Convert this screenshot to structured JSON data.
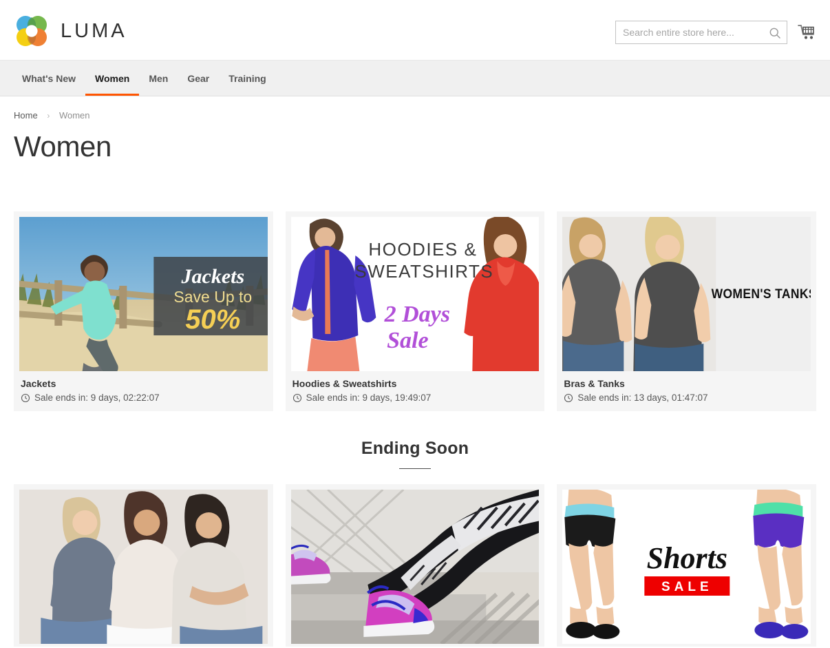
{
  "header": {
    "brand": "LUMA",
    "logo_icon": "luma-flower-logo",
    "logo_colors": {
      "blue": "#3ba9dd",
      "green": "#6bb33e",
      "yellow": "#f4cc00",
      "orange": "#ee7623",
      "olive": "#7a6a22",
      "teal": "#2f7f52"
    },
    "search": {
      "placeholder": "Search entire store here...",
      "value": "",
      "icon": "search-icon"
    },
    "cart": {
      "icon": "shopping-cart-icon",
      "label": "My Cart"
    }
  },
  "nav": {
    "items": [
      {
        "label": "What's New",
        "active": false
      },
      {
        "label": "Women",
        "active": true
      },
      {
        "label": "Men",
        "active": false
      },
      {
        "label": "Gear",
        "active": false
      },
      {
        "label": "Training",
        "active": false
      }
    ],
    "active_underline_color": "#ff5501"
  },
  "breadcrumb": {
    "home": "Home",
    "separator": "›",
    "current": "Women"
  },
  "page": {
    "title": "Women"
  },
  "promo_row_1": [
    {
      "title": "Jackets",
      "sale_text": "Sale ends in: 9 days, 02:22:07",
      "clock_icon": "clock-icon",
      "banner": {
        "heading": "Jackets",
        "line2": "Save Up to",
        "line3": "50%",
        "heading_color": "#ffffff",
        "accent_color": "#f5d76e",
        "overlay_color": "#3f4448"
      }
    },
    {
      "title": "Hoodies & Sweatshirts",
      "sale_text": "Sale ends in: 9 days, 19:49:07",
      "clock_icon": "clock-icon",
      "banner": {
        "line1": "HOODIES &",
        "line2": "SWEATSHIRTS",
        "script1": "2 Days",
        "script2": "Sale",
        "heading_color": "#3a3a3a",
        "accent_color": "#b14fd8"
      }
    },
    {
      "title": "Bras & Tanks",
      "sale_text": "Sale ends in: 13 days, 01:47:07",
      "clock_icon": "clock-icon",
      "banner": {
        "heading": "WOMEN'S TANKS",
        "heading_color": "#111111"
      }
    }
  ],
  "ending_soon": {
    "heading": "Ending Soon"
  },
  "promo_row_2": [
    {
      "alt": "three-women-in-tees",
      "banner": {
        "heading": ""
      }
    },
    {
      "alt": "leggings-and-sneakers-on-steps",
      "banner": {
        "heading": ""
      }
    },
    {
      "alt": "women-in-shorts",
      "banner": {
        "script": "Shorts",
        "tag": "SALE",
        "tag_bg": "#ee0000",
        "tag_color": "#ffffff",
        "script_color": "#111111"
      }
    }
  ]
}
